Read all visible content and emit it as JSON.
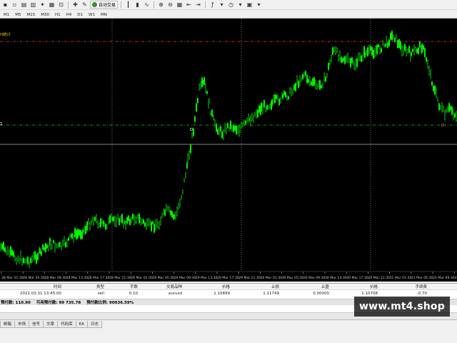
{
  "toolbar": {
    "auto_trade_label": "自动交易",
    "timeframes": [
      "M1",
      "M5",
      "M15",
      "M30",
      "H1",
      "H4",
      "D1",
      "W1",
      "MN"
    ]
  },
  "chart": {
    "indicator_label": "H统计",
    "x_ticks": [
      "28 Mar 01:30",
      "28 Mar 05:30",
      "28 Mar 09:30",
      "28 Mar 13:30",
      "28 Mar 17:30",
      "28 Mar 21:30",
      "29 Mar 01:30",
      "29 Mar 05:30",
      "29 Mar 09:30",
      "29 Mar 13:30",
      "29 Mar 17:30",
      "29 Mar 21:30",
      "30 Mar 01:30",
      "30 Mar 05:30",
      "30 Mar 09:30",
      "30 Mar 13:30",
      "30 Mar 17:30",
      "30 Mar 21:30",
      "31 Mar 01:30",
      "31 Mar 05:30",
      "31 Mar 09:30",
      "31 Mar 13:30"
    ],
    "colors": {
      "background": "#000000",
      "candle": "#00ff00",
      "grid": "#c0c0c0",
      "stop_level": "#ff3030",
      "price_level": "#00cc33"
    }
  },
  "trades": {
    "headers": [
      "时间",
      "类型",
      "手数",
      "交易品种",
      "价格",
      "止损",
      "止盈",
      "价格",
      "手续费"
    ],
    "row": [
      "2022.03.31 13:45:00",
      "sell",
      "0.10",
      "eurusd",
      "1.10899",
      "1.11749",
      "0.00000",
      "1.10708",
      "-0.70"
    ]
  },
  "balance": {
    "segments": [
      "预付款: 110.90",
      "可用预付款: 99 735.78",
      "预付款比例: 90036.59%"
    ]
  },
  "tabs": [
    "邮箱",
    "市场",
    "信号",
    "文章",
    "代码库",
    "EA",
    "日志"
  ],
  "watermark": "www.mt4.shop"
}
